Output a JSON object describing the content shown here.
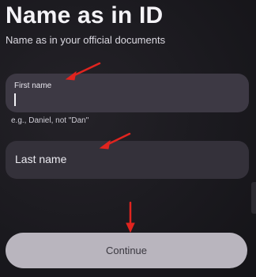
{
  "header": {
    "title": "Name as in ID",
    "subtitle": "Name as in your official documents"
  },
  "form": {
    "first_name": {
      "label": "First name",
      "value": "",
      "hint": "e.g., Daniel, not \"Dan\""
    },
    "last_name": {
      "placeholder": "Last name",
      "value": ""
    }
  },
  "actions": {
    "continue_label": "Continue"
  },
  "annotations": {
    "arrow_color": "#e0241f"
  },
  "colors": {
    "background": "#1b1a1f",
    "field": "#3a3741",
    "button": "#b9b5be"
  }
}
